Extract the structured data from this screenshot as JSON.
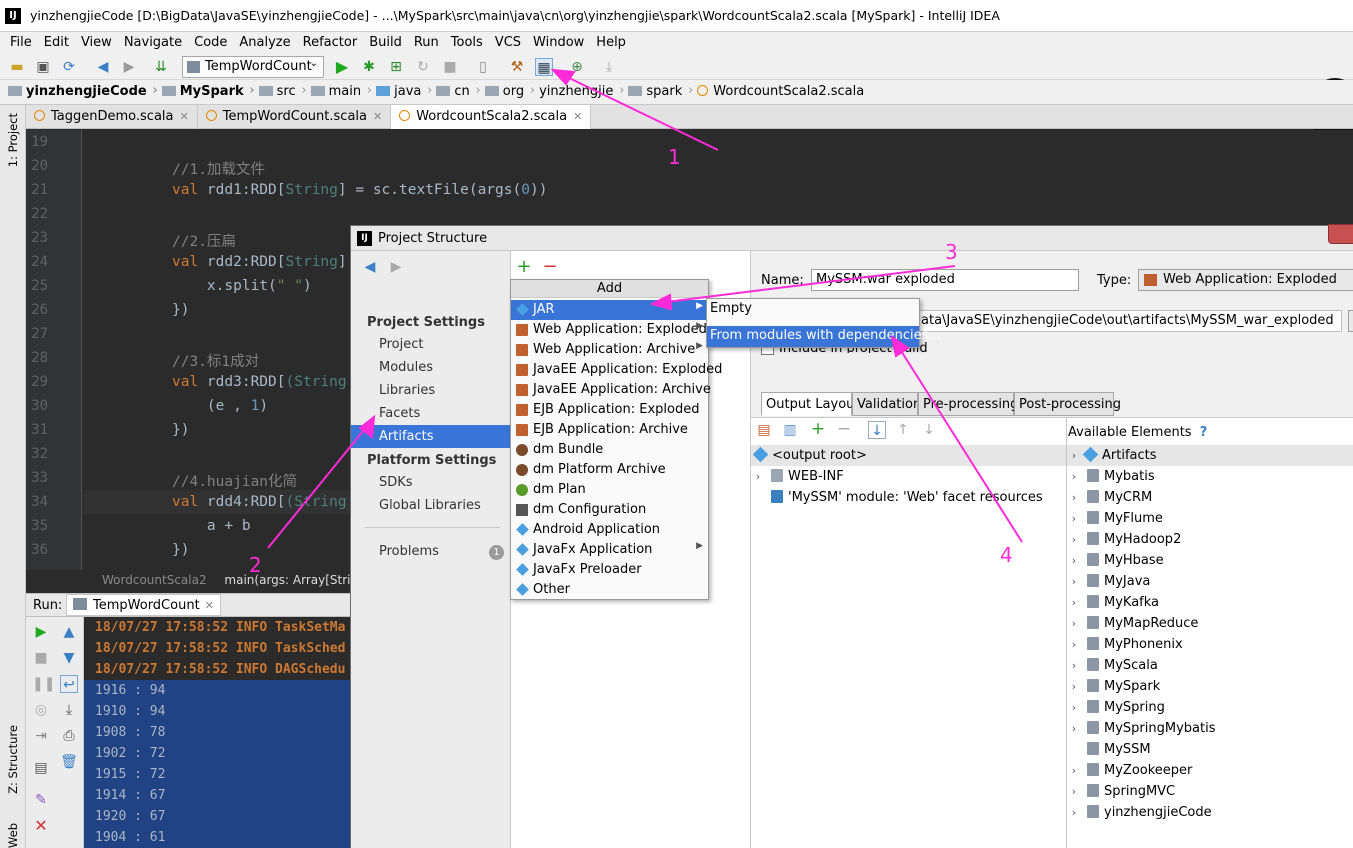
{
  "window": {
    "title": "yinzhengjieCode [D:\\BigData\\JavaSE\\yinzhengjieCode] - ...\\MySpark\\src\\main\\java\\cn\\org\\yinzhengjie\\spark\\WordcountScala2.scala [MySpark] - IntelliJ IDEA"
  },
  "menu": [
    "File",
    "Edit",
    "View",
    "Navigate",
    "Code",
    "Analyze",
    "Refactor",
    "Build",
    "Run",
    "Tools",
    "VCS",
    "Window",
    "Help"
  ],
  "toolbar": {
    "run_config": "TempWordCount"
  },
  "breadcrumbs": [
    "yinzhengjieCode",
    "MySpark",
    "src",
    "main",
    "java",
    "cn",
    "org",
    "yinzhengjie",
    "spark",
    "WordcountScala2.scala"
  ],
  "side_tools": {
    "project": "1: Project",
    "structure": "Z: Structure",
    "web": "Web"
  },
  "editor_tabs": [
    {
      "label": "TaggenDemo.scala",
      "active": false
    },
    {
      "label": "TempWordCount.scala",
      "active": false
    },
    {
      "label": "WordcountScala2.scala",
      "active": true
    }
  ],
  "code_lines": [
    {
      "num": "19",
      "text": ""
    },
    {
      "num": "20",
      "text": "//1.加载文件"
    },
    {
      "num": "21",
      "text": "val rdd1:RDD[String] = sc.textFile(args(0))"
    },
    {
      "num": "22",
      "text": ""
    },
    {
      "num": "23",
      "text": "//2.压扁"
    },
    {
      "num": "24",
      "text": "val rdd2:RDD[String]"
    },
    {
      "num": "25",
      "text": "    x.split(\" \")"
    },
    {
      "num": "26",
      "text": "})"
    },
    {
      "num": "27",
      "text": ""
    },
    {
      "num": "28",
      "text": "//3.标1成对"
    },
    {
      "num": "29",
      "text": "val rdd3:RDD[(String"
    },
    {
      "num": "30",
      "text": "    (e , 1)"
    },
    {
      "num": "31",
      "text": "})"
    },
    {
      "num": "32",
      "text": ""
    },
    {
      "num": "33",
      "text": "//4.huajian化简"
    },
    {
      "num": "34",
      "text": "val rdd4:RDD[(String"
    },
    {
      "num": "35",
      "text": "    a + b"
    },
    {
      "num": "36",
      "text": "})"
    }
  ],
  "editor_breadcrumb": {
    "file": "WordcountScala2",
    "method": "main(args: Array[String"
  },
  "run_panel": {
    "label": "Run:",
    "tab": "TempWordCount"
  },
  "console": [
    {
      "text": "18/07/27 17:58:52 INFO TaskSetMa",
      "kind": "log"
    },
    {
      "text": "18/07/27 17:58:52 INFO TaskSched",
      "kind": "log"
    },
    {
      "text": "18/07/27 17:58:52 INFO DAGSchedu",
      "kind": "log"
    },
    {
      "text": "1916 : 94",
      "kind": "sel"
    },
    {
      "text": "1910 : 94",
      "kind": "sel"
    },
    {
      "text": "1908 : 78",
      "kind": "sel"
    },
    {
      "text": "1902 : 72",
      "kind": "sel"
    },
    {
      "text": "1915 : 72",
      "kind": "sel"
    },
    {
      "text": "1914 : 67",
      "kind": "sel"
    },
    {
      "text": "1920 : 67",
      "kind": "sel"
    },
    {
      "text": "1904 : 61",
      "kind": "sel"
    }
  ],
  "dialog": {
    "title": "Project Structure",
    "project_settings_header": "Project Settings",
    "project_settings": [
      "Project",
      "Modules",
      "Libraries",
      "Facets",
      "Artifacts"
    ],
    "platform_settings_header": "Platform Settings",
    "platform_settings": [
      "SDKs",
      "Global Libraries"
    ],
    "problems": "Problems",
    "problems_count": "1",
    "selected_nav": "Artifacts",
    "name_label": "Name:",
    "name_value": "MySSM:war exploded",
    "type_label": "Type:",
    "type_value": "Web Application: Exploded",
    "output_dir_value": "ata\\JavaSE\\yinzhengjieCode\\out\\artifacts\\MySSM_war_exploded",
    "include_in_build": "Include in project build",
    "tabs": [
      "Output Layout",
      "Validation",
      "Pre-processing",
      "Post-processing"
    ],
    "available_elements": "Available Elements",
    "help_mark": "?",
    "layout_tree": [
      {
        "label": "<output root>",
        "indent": 0,
        "arrow": false,
        "icon": "diamond"
      },
      {
        "label": "WEB-INF",
        "indent": 1,
        "arrow": true,
        "icon": "folder"
      },
      {
        "label": "'MySSM' module: 'Web' facet resources",
        "indent": 1,
        "arrow": false,
        "icon": "web"
      }
    ],
    "available": [
      "Artifacts",
      "Mybatis",
      "MyCRM",
      "MyFlume",
      "MyHadoop2",
      "MyHbase",
      "MyJava",
      "MyKafka",
      "MyMapReduce",
      "MyPhonenix",
      "MyScala",
      "MySpark",
      "MySpring",
      "MySpringMybatis",
      "MySSM",
      "MyZookeeper",
      "SpringMVC",
      "yinzhengjieCode"
    ]
  },
  "add_popup": {
    "header": "Add",
    "items": [
      {
        "label": "JAR",
        "submenu": true,
        "selected": true,
        "icon": "diamond"
      },
      {
        "label": "Web Application: Exploded",
        "submenu": true,
        "selected": false,
        "icon": "web"
      },
      {
        "label": "Web Application: Archive",
        "submenu": true,
        "selected": false,
        "icon": "web"
      },
      {
        "label": "JavaEE Application: Exploded",
        "submenu": false,
        "selected": false,
        "icon": "web"
      },
      {
        "label": "JavaEE Application: Archive",
        "submenu": false,
        "selected": false,
        "icon": "web"
      },
      {
        "label": "EJB Application: Exploded",
        "submenu": false,
        "selected": false,
        "icon": "web"
      },
      {
        "label": "EJB Application: Archive",
        "submenu": false,
        "selected": false,
        "icon": "web"
      },
      {
        "label": "dm Bundle",
        "submenu": false,
        "selected": false,
        "icon": "dm"
      },
      {
        "label": "dm Platform Archive",
        "submenu": false,
        "selected": false,
        "icon": "dm"
      },
      {
        "label": "dm Plan",
        "submenu": false,
        "selected": false,
        "icon": "plan"
      },
      {
        "label": "dm Configuration",
        "submenu": false,
        "selected": false,
        "icon": "conf"
      },
      {
        "label": "Android Application",
        "submenu": false,
        "selected": false,
        "icon": "diamond"
      },
      {
        "label": "JavaFx Application",
        "submenu": true,
        "selected": false,
        "icon": "diamond"
      },
      {
        "label": "JavaFx Preloader",
        "submenu": false,
        "selected": false,
        "icon": "diamond"
      },
      {
        "label": "Other",
        "submenu": false,
        "selected": false,
        "icon": "diamond"
      }
    ]
  },
  "jar_submenu": [
    {
      "label": "Empty",
      "selected": false
    },
    {
      "label": "From modules with dependencies...",
      "selected": true
    }
  ],
  "annotations": [
    "1",
    "2",
    "3",
    "4"
  ],
  "colors": {
    "annotation": "#ff2bd9",
    "selection": "#3875d7",
    "editor_bg": "#2b2b2b"
  }
}
